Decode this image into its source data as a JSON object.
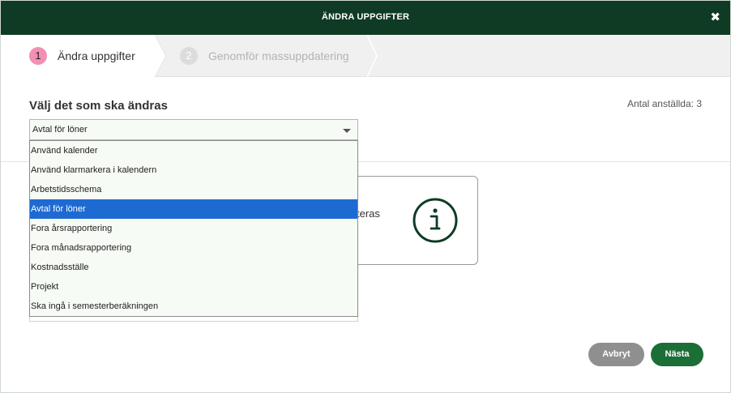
{
  "dialog": {
    "title": "ÄNDRA UPPGIFTER",
    "close_symbol": "✖"
  },
  "steps": [
    {
      "number": "1",
      "label": "Ändra uppgifter",
      "active": true
    },
    {
      "number": "2",
      "label": "Genomför massuppdatering",
      "active": false
    }
  ],
  "form": {
    "section_title": "Välj det som ska ändras",
    "employee_count": "Antal anställda: 3",
    "select_value": "Avtal för löner",
    "options": [
      "Använd kalender",
      "Använd klarmarkera i kalendern",
      "Arbetstidsschema",
      "Avtal för löner",
      "Fora årsrapportering",
      "Fora månadsrapportering",
      "Kostnadsställe",
      "Projekt",
      "Ska ingå i semesterberäkningen"
    ],
    "selected_index": 3
  },
  "info": {
    "text_visible": "teras",
    "icon": "info-circle-icon"
  },
  "buttons": {
    "cancel": "Avbryt",
    "next": "Nästa"
  },
  "colors": {
    "header_bg": "#0f3b24",
    "active_step": "#f38fb3",
    "selected_option": "#1e6ad3",
    "next_button": "#1b6e35",
    "cancel_button": "#8f8f8f"
  }
}
